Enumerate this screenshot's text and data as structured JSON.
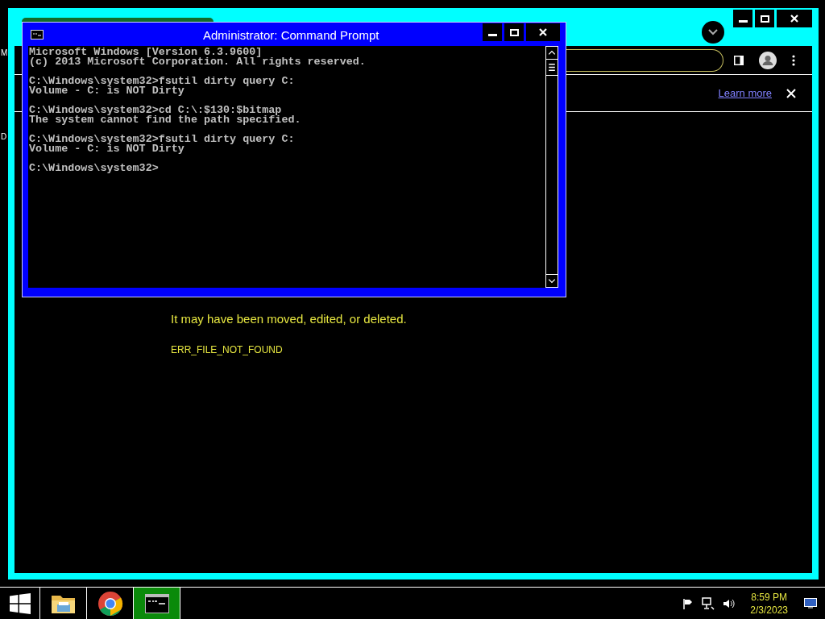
{
  "desktop_letters": [
    "M",
    "D"
  ],
  "browser": {
    "infobar": {
      "link": "Learn more"
    },
    "error": {
      "message": "It may have been moved, edited, or deleted.",
      "code": "ERR_FILE_NOT_FOUND"
    }
  },
  "cmd": {
    "title": "Administrator:  Command Prompt",
    "blocks": [
      [
        "Microsoft Windows [Version 6.3.9600]",
        "(c) 2013 Microsoft Corporation. All rights reserved."
      ],
      [
        "C:\\Windows\\system32>fsutil dirty query C:",
        "Volume - C: is NOT Dirty"
      ],
      [
        "C:\\Windows\\system32>cd C:\\:$130:$bitmap",
        "The system cannot find the path specified."
      ],
      [
        "C:\\Windows\\system32>fsutil dirty query C:",
        "Volume - C: is NOT Dirty"
      ],
      [
        "C:\\Windows\\system32>"
      ]
    ]
  },
  "taskbar": {
    "apps": [
      {
        "kind": "start",
        "selected": false
      },
      {
        "kind": "explorer",
        "selected": false
      },
      {
        "kind": "chrome",
        "selected": false
      },
      {
        "kind": "cmd",
        "selected": true
      }
    ],
    "clock": {
      "time": "8:59 PM",
      "date": "2/3/2023"
    }
  }
}
